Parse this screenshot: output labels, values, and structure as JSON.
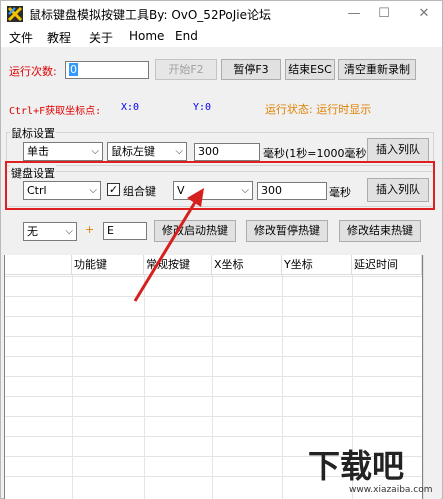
{
  "window": {
    "title": "鼠标键盘模拟按键工具By:  OvO_52PoJie论坛",
    "minimize_glyph": "—",
    "maximize_glyph": "☐",
    "close_glyph": "✕"
  },
  "menu": [
    "文件",
    "教程",
    "关于",
    "Home",
    "End"
  ],
  "run_row": {
    "run_count_label": "运行次数:",
    "run_count_value": "0",
    "start_label": "开始F2",
    "pause_label": "暂停F3",
    "end_label": "结束ESC",
    "clear_label": "清空重新录制"
  },
  "coord_row": {
    "hint": "Ctrl+F获取坐标点:",
    "x_label": "X:0",
    "y_label": "Y:0",
    "status": "运行状态: 运行时显示"
  },
  "mouse": {
    "group_title": "鼠标设置",
    "click_type": "单击",
    "button": "鼠标左键",
    "delay": "300",
    "unit_note": "毫秒(1秒=1000毫秒",
    "insert_label": "插入列队"
  },
  "keyboard": {
    "group_title": "键盘设置",
    "modifier": "Ctrl",
    "combo_label": "组合键",
    "combo_checked": true,
    "key": "V",
    "delay": "300",
    "unit": "毫秒",
    "insert_label": "插入列队"
  },
  "hotkey": {
    "modifier": "无",
    "plus": "+",
    "key": "E",
    "start_hotkey_label": "修改启动热键",
    "pause_hotkey_label": "修改暂停热键",
    "end_hotkey_label": "修改结束热键"
  },
  "table": {
    "columns": [
      "功能键",
      "常规按键",
      "X坐标",
      "Y坐标",
      "延迟时间"
    ]
  },
  "watermark": {
    "brand": "下载吧",
    "url": "www.xiazaiba.com"
  },
  "colors": {
    "accent_red": "#e02020",
    "label_red": "#ff0000",
    "label_blue": "#0000ff",
    "status_orange": "#e08000"
  }
}
